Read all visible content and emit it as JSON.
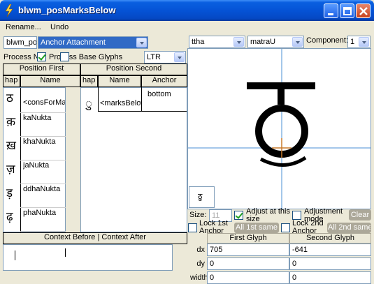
{
  "window": {
    "title": "blwm_posMarksBelow",
    "minimize_icon": "minimize-icon",
    "maximize_icon": "maximize-icon",
    "close_icon": "close-icon"
  },
  "menu": {
    "rename": "Rename...",
    "undo": "Undo"
  },
  "toolbar": {
    "lookup_name": "blwm_po",
    "lookup_type": "Anchor Attachment",
    "process_label": "Process N",
    "process_checked": true,
    "base_label": "Process Base Glyphs",
    "direction": "LTR"
  },
  "first_table": {
    "title": "Position First",
    "col_glyph": "hap",
    "col_name": "Name",
    "rows": [
      {
        "glyph": "ठ",
        "name": "<consForMa"
      },
      {
        "glyph": "क़",
        "name": "kaNukta"
      },
      {
        "glyph": "ख़",
        "name": "khaNukta"
      },
      {
        "glyph": "ज़",
        "name": "jaNukta"
      },
      {
        "glyph": "ड़",
        "name": "ddhaNukta"
      },
      {
        "glyph": "ढ़",
        "name": "phaNukta"
      }
    ]
  },
  "second_table": {
    "title": "Position Second",
    "col_glyph": "hap",
    "col_name": "Name",
    "col_anchor": "Anchor",
    "rows": [
      {
        "glyph": "ु",
        "name": "<marksBelow",
        "anchor": "bottom"
      }
    ]
  },
  "context": {
    "header": "Context Before | Context After"
  },
  "preview": {
    "first_glyph": "ttha",
    "second_glyph": "matraU",
    "component_label": "Component:",
    "component_value": "1",
    "base_char": "ठ",
    "thumb_char": "ठु",
    "accent_color": "#4a8fd6",
    "anchor_color": "#c87a2c"
  },
  "controls": {
    "size_label": "Size:",
    "size_value": "11",
    "adjust_size_label": "Adjust at this size",
    "adjust_size_checked": true,
    "adjust_mode_label": "Adjustment mode",
    "adjust_mode_checked": false,
    "clear_label": "Clear",
    "lock1_label": "Lock 1st Anchor",
    "lock1_checked": false,
    "all1_label": "All 1st same",
    "lock2_label": "Lock 2nd Anchor",
    "lock2_checked": false,
    "all2_label": "All 2nd same"
  },
  "grid": {
    "col_first": "First Glyph",
    "col_second": "Second Glyph",
    "rows": [
      {
        "label": "dx",
        "first": "705",
        "second": "-641"
      },
      {
        "label": "dy",
        "first": "0",
        "second": "0"
      },
      {
        "label": "width",
        "first": "0",
        "second": "0"
      }
    ]
  }
}
